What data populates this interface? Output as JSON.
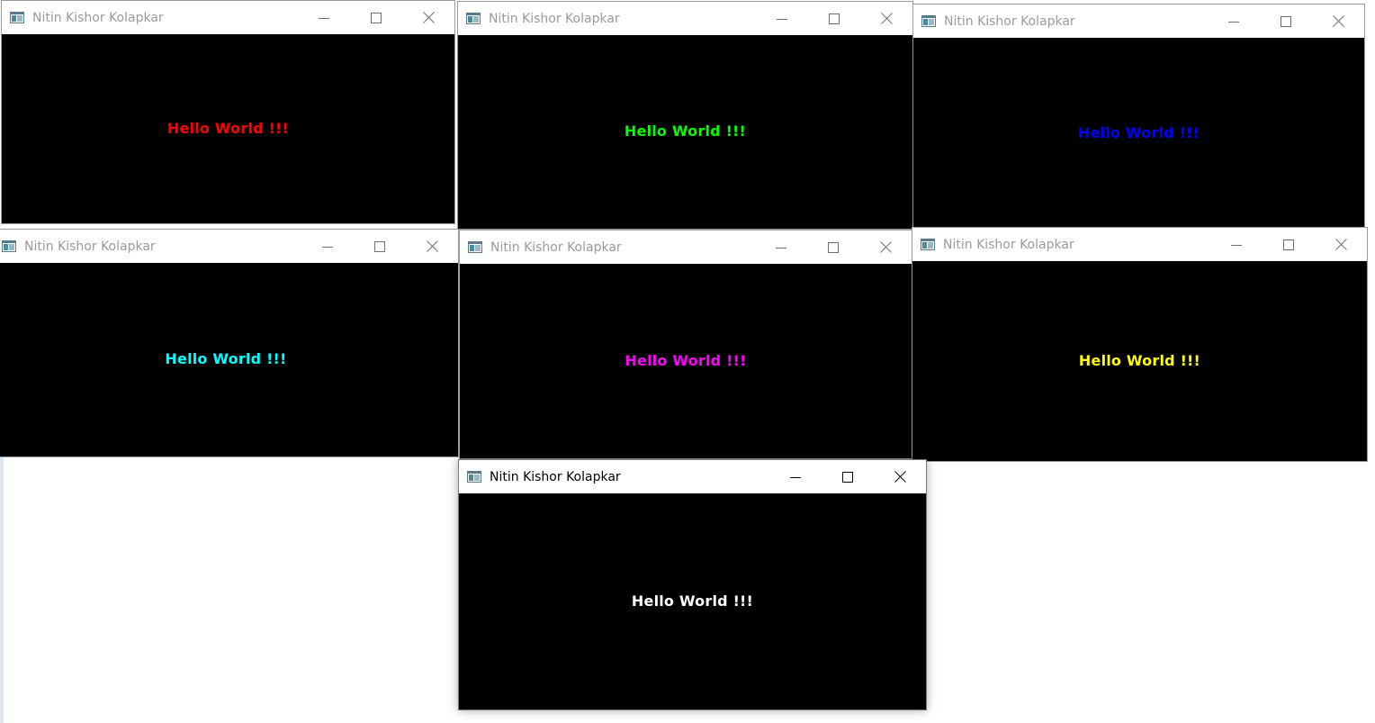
{
  "windows": [
    {
      "title": "Nitin Kishor Kolapkar",
      "message": "Hello World !!!",
      "text_color": "#ff0000",
      "active": false
    },
    {
      "title": "Nitin Kishor Kolapkar",
      "message": "Hello World !!!",
      "text_color": "#00ff00",
      "active": false
    },
    {
      "title": "Nitin Kishor Kolapkar",
      "message": "Hello World !!!",
      "text_color": "#0000ff",
      "active": false
    },
    {
      "title": "Nitin Kishor Kolapkar",
      "message": "Hello World !!!",
      "text_color": "#00ffff",
      "active": false
    },
    {
      "title": "Nitin Kishor Kolapkar",
      "message": "Hello World !!!",
      "text_color": "#ff00ff",
      "active": false
    },
    {
      "title": "Nitin Kishor Kolapkar",
      "message": "Hello World !!!",
      "text_color": "#ffff00",
      "active": false
    },
    {
      "title": "Nitin Kishor Kolapkar",
      "message": "Hello World !!!",
      "text_color": "#ffffff",
      "active": true
    }
  ],
  "icons": {
    "app": "app-window-icon",
    "minimize": "minimize-icon",
    "maximize": "maximize-icon",
    "close": "close-icon"
  }
}
